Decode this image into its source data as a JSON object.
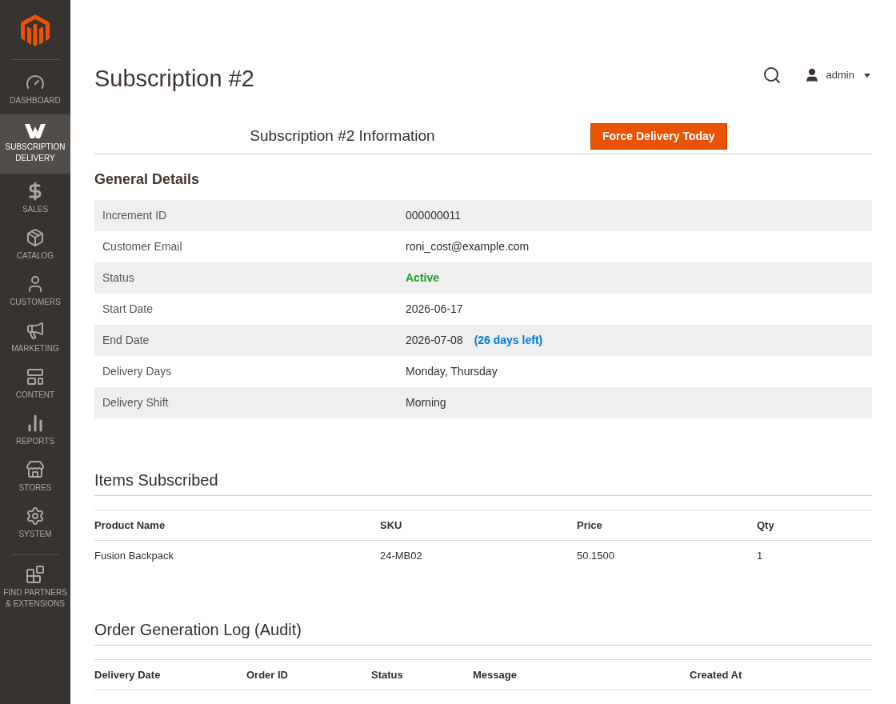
{
  "sidebar": {
    "items": [
      {
        "label": "DASHBOARD",
        "selected": false
      },
      {
        "label": "SUBSCRIPTION DELIVERY",
        "selected": true
      },
      {
        "label": "SALES",
        "selected": false
      },
      {
        "label": "CATALOG",
        "selected": false
      },
      {
        "label": "CUSTOMERS",
        "selected": false
      },
      {
        "label": "MARKETING",
        "selected": false
      },
      {
        "label": "CONTENT",
        "selected": false
      },
      {
        "label": "REPORTS",
        "selected": false
      },
      {
        "label": "STORES",
        "selected": false
      },
      {
        "label": "SYSTEM",
        "selected": false
      },
      {
        "label": "FIND PARTNERS & EXTENSIONS",
        "selected": false
      }
    ]
  },
  "header": {
    "title": "Subscription #2",
    "user": "admin"
  },
  "info_bar": {
    "title": "Subscription #2 Information",
    "button": "Force Delivery Today"
  },
  "general_details": {
    "title": "General Details",
    "rows": [
      {
        "kind": "text",
        "label": "Increment ID",
        "value": "000000011"
      },
      {
        "kind": "text",
        "label": "Customer Email",
        "value": "roni_cost@example.com"
      },
      {
        "kind": "status",
        "label": "Status",
        "value": "Active"
      },
      {
        "kind": "text",
        "label": "Start Date",
        "value": "2026-06-17"
      },
      {
        "kind": "note",
        "label": "End Date",
        "value": "2026-07-08",
        "note": "(26 days left)"
      },
      {
        "kind": "text",
        "label": "Delivery Days",
        "value": "Monday, Thursday"
      },
      {
        "kind": "text",
        "label": "Delivery Shift",
        "value": "Morning"
      }
    ]
  },
  "items_subscribed": {
    "title": "Items Subscribed",
    "columns": [
      "Product Name",
      "SKU",
      "Price",
      "Qty"
    ],
    "rows": [
      [
        "Fusion Backpack",
        "24-MB02",
        "50.1500",
        "1"
      ]
    ]
  },
  "order_log": {
    "title": "Order Generation Log (Audit)",
    "columns": [
      "Delivery Date",
      "Order ID",
      "Status",
      "Message",
      "Created At"
    ]
  }
}
